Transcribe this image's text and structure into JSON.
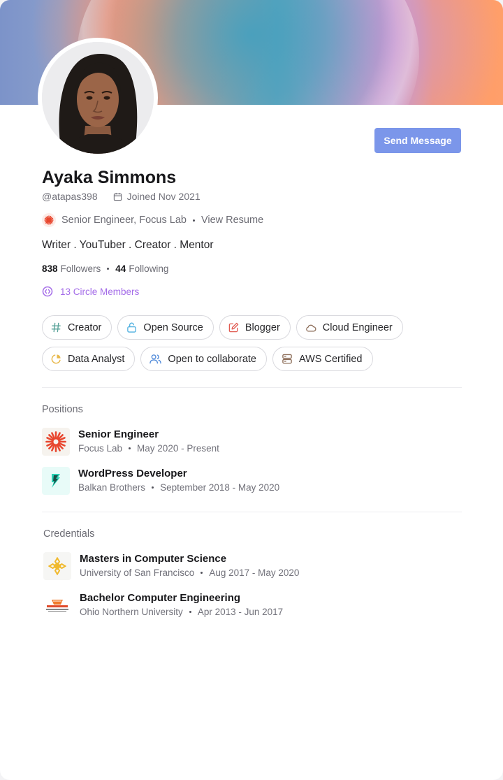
{
  "profile": {
    "name": "Ayaka Simmons",
    "handle": "@atapas398",
    "joined": "Joined Nov 2021",
    "job": "Senior Engineer, Focus Lab",
    "resume_link": "View Resume",
    "tagline": "Writer . YouTuber . Creator . Mentor",
    "followers_count": "838",
    "followers_label": "Followers",
    "following_count": "44",
    "following_label": "Following",
    "circle_members": "13 Circle Members"
  },
  "actions": {
    "send_message": "Send Message"
  },
  "tags": [
    {
      "label": "Creator",
      "icon": "hash-icon",
      "color": "#5aa39a"
    },
    {
      "label": "Open Source",
      "icon": "unlock-icon",
      "color": "#4fb0e0"
    },
    {
      "label": "Blogger",
      "icon": "edit-icon",
      "color": "#e0584f"
    },
    {
      "label": "Cloud Engineer",
      "icon": "cloud-icon",
      "color": "#8a6a55"
    },
    {
      "label": "Data Analyst",
      "icon": "pie-chart-icon",
      "color": "#e8b84a"
    },
    {
      "label": "Open to collaborate",
      "icon": "users-icon",
      "color": "#4a86d8"
    },
    {
      "label": "AWS Certified",
      "icon": "server-icon",
      "color": "#8a6a55"
    }
  ],
  "positions": {
    "title": "Positions",
    "items": [
      {
        "title": "Senior Engineer",
        "org": "Focus Lab",
        "period": "May 2020 - Present",
        "logo": "focus-lab-logo"
      },
      {
        "title": "WordPress Developer",
        "org": "Balkan Brothers",
        "period": "September 2018 - May 2020",
        "logo": "balkan-brothers-logo"
      }
    ]
  },
  "credentials": {
    "title": "Credentials",
    "items": [
      {
        "title": "Masters in Computer Science",
        "org": "University of San Francisco",
        "period": "Aug 2017 - May 2020",
        "logo": "usf-logo"
      },
      {
        "title": "Bachelor Computer Engineering",
        "org": "Ohio Northern University",
        "period": "Apr 2013 - Jun 2017",
        "logo": "onu-logo"
      }
    ]
  },
  "colors": {
    "accent": "#7b96ea",
    "circle": "#a46ce8",
    "focus_lab": "#e8472f"
  }
}
